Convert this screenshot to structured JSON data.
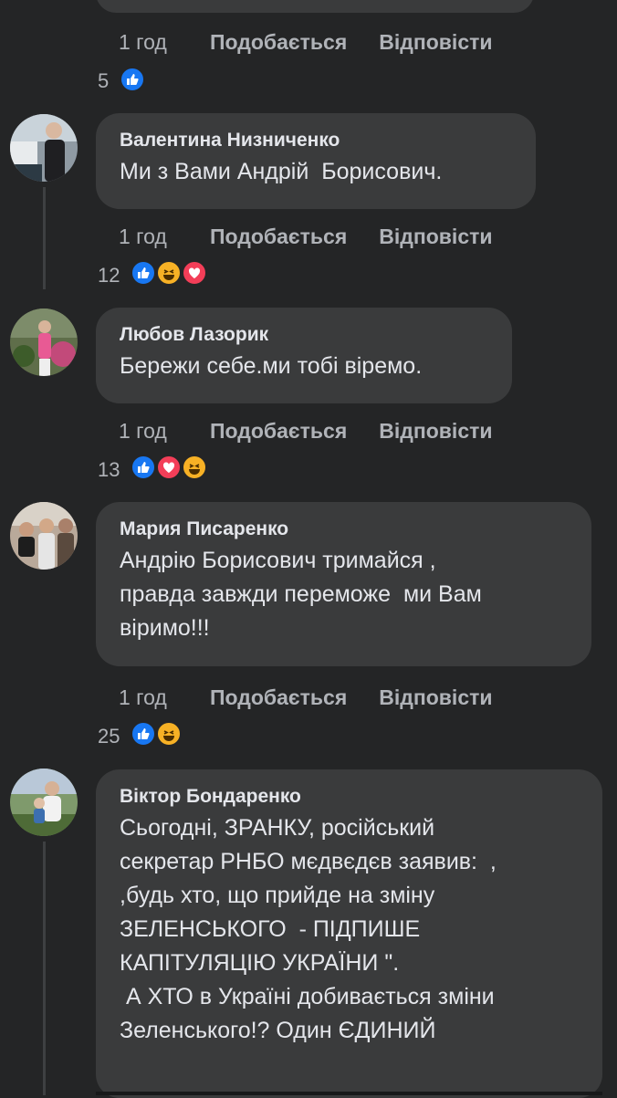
{
  "comments": [
    {
      "reactions_count": "5"
    },
    {
      "author": "Валентина Низниченко",
      "text": "Ми з Вами Андрій  Борисович.",
      "reactions_count": "12"
    },
    {
      "author": "Любов Лазорик",
      "text": "Бережи себе.ми тобі віремо.",
      "reactions_count": "13"
    },
    {
      "author": "Мария Писаренко",
      "text": "Андрію Борисович тримайся ,\nправда завжди переможе  ми Вам\nвіримо!!!",
      "reactions_count": "25"
    },
    {
      "author": "Віктор Бондаренко",
      "text": "Сьогодні, ЗРАНКУ, російський\nсекретар РНБО мєдвєдєв заявив:  ,\n,будь хто, що прийде на зміну\nЗЕЛЕНСЬКОГО  - ПІДПИШЕ\nКАПІТУЛЯЦІЮ УКРАЇНИ \".\n А ХТО в Україні добивається зміни\nЗеленського!? Один ЄДИНИЙ"
    }
  ],
  "actions": {
    "time": "1 год",
    "like": "Подобається",
    "reply": "Відповісти"
  },
  "colors": {
    "background": "#242526",
    "bubble": "#3a3b3c",
    "like": "#1877f2",
    "love": "#f33e58",
    "haha": "#f7b125"
  }
}
